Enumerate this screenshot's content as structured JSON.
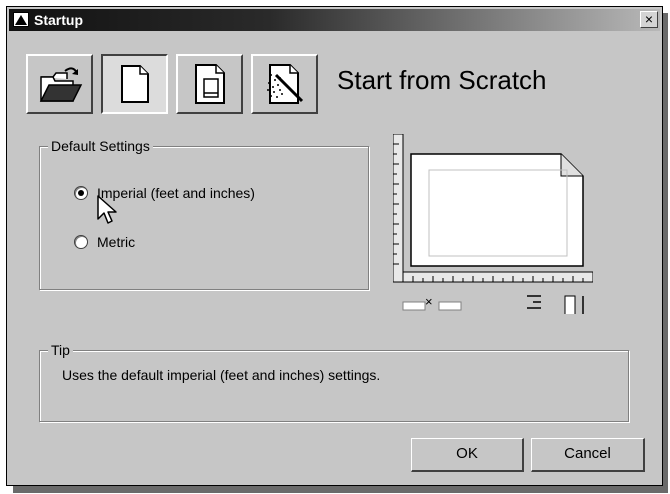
{
  "window": {
    "title": "Startup",
    "close_glyph": "×"
  },
  "toolbar": {
    "buttons": [
      {
        "icon": "open-folder-icon",
        "active": false
      },
      {
        "icon": "blank-page-icon",
        "active": true
      },
      {
        "icon": "template-page-icon",
        "active": false
      },
      {
        "icon": "wizard-page-icon",
        "active": false
      }
    ],
    "heading": "Start from Scratch"
  },
  "default_settings": {
    "legend": "Default Settings",
    "options": [
      {
        "label": "Imperial (feet and inches)",
        "selected": true
      },
      {
        "label": "Metric",
        "selected": false
      }
    ]
  },
  "preview": {
    "units_glyph": "×"
  },
  "tip": {
    "legend": "Tip",
    "text": "Uses the default imperial (feet and inches) settings."
  },
  "buttons": {
    "ok_label": "OK",
    "cancel_label": "Cancel"
  },
  "colors": {
    "dialog_bg": "#c6c6c6",
    "titlebar_dark": "#111111",
    "titlebar_light": "#b8b8b8"
  }
}
